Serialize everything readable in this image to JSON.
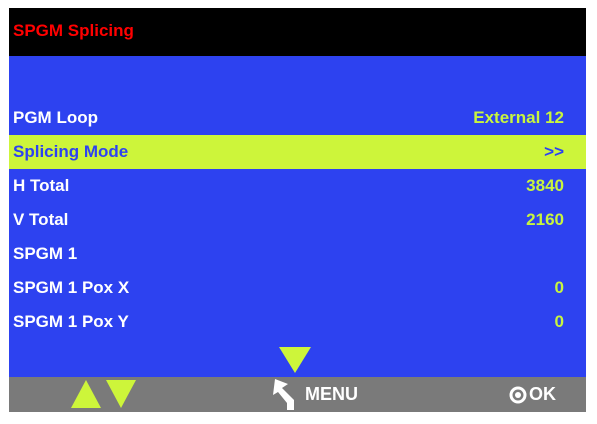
{
  "header": {
    "title": "SPGM Splicing"
  },
  "rows": [
    {
      "label": "PGM Loop",
      "value": "External 12"
    },
    {
      "label": "Splicing Mode",
      "value": ">>"
    },
    {
      "label": "H Total",
      "value": "3840"
    },
    {
      "label": "V Total",
      "value": "2160"
    },
    {
      "label": "SPGM 1",
      "value": ""
    },
    {
      "label": "SPGM 1 Pox X",
      "value": "0"
    },
    {
      "label": "SPGM 1 Pox Y",
      "value": "0"
    }
  ],
  "selected_index": 1,
  "footer": {
    "up_icon": "triangle-up-icon",
    "down_icon": "triangle-down-icon",
    "back_icon": "back-arrow-icon",
    "menu_label": "MENU",
    "ok_icon": "circle-dot-icon",
    "ok_label": "OK"
  },
  "colors": {
    "title_bg": "#000000",
    "title_text": "#ff0000",
    "menu_bg": "#2d42f0",
    "highlight": "#cdf53a",
    "value_text": "#c8f53e",
    "footer_bg": "#7a7a7a"
  }
}
